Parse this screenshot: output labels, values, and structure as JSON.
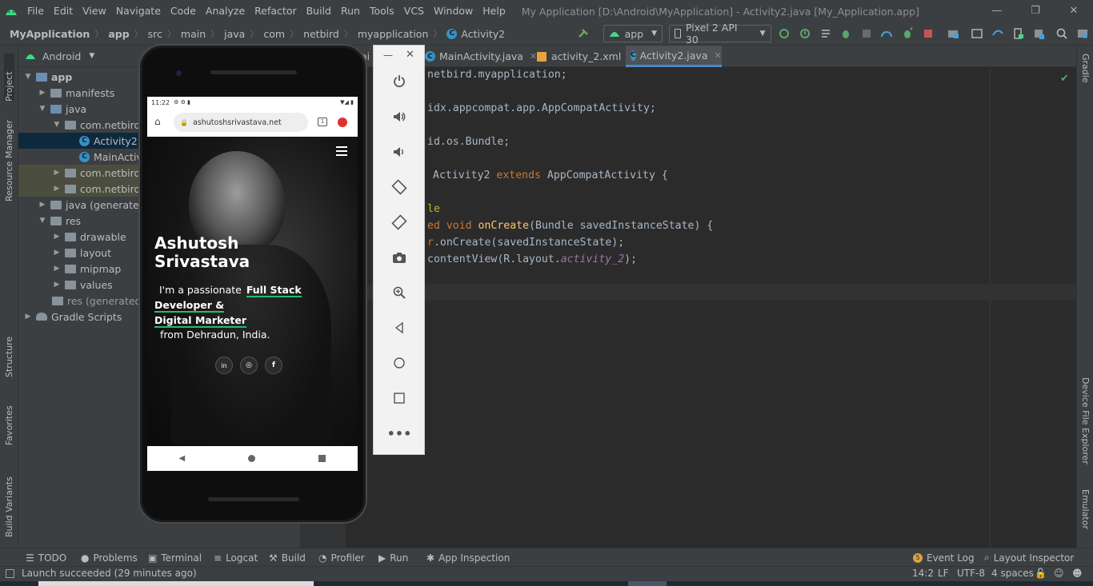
{
  "menubar": {
    "items": [
      "File",
      "Edit",
      "View",
      "Navigate",
      "Code",
      "Analyze",
      "Refactor",
      "Build",
      "Run",
      "Tools",
      "VCS",
      "Window",
      "Help"
    ],
    "title": "My Application [D:\\Android\\MyApplication] - Activity2.java [My_Application.app]"
  },
  "navbar": {
    "crumbs": [
      "MyApplication",
      "app",
      "src",
      "main",
      "java",
      "com",
      "netbird",
      "myapplication",
      "Activity2"
    ],
    "run_config": "app",
    "device": "Pixel 2 API 30"
  },
  "left_strip": {
    "project": "Project",
    "resource_manager": "Resource Manager",
    "structure": "Structure",
    "favorites": "Favorites",
    "build_variants": "Build Variants"
  },
  "right_strip": {
    "gradle": "Gradle",
    "device_file_explorer": "Device File Explorer",
    "emulator": "Emulator"
  },
  "project": {
    "view": "Android",
    "tree": [
      {
        "label": "app"
      },
      {
        "label": "manifests"
      },
      {
        "label": "java"
      },
      {
        "label": "com.netbird.n"
      },
      {
        "label": "Activity2"
      },
      {
        "label": "MainActiv"
      },
      {
        "label": "com.netbird.n"
      },
      {
        "label": "com.netbird.n"
      },
      {
        "label": "java (generated)"
      },
      {
        "label": "res"
      },
      {
        "label": "drawable"
      },
      {
        "label": "layout"
      },
      {
        "label": "mipmap"
      },
      {
        "label": "values"
      },
      {
        "label": "res (generated)"
      },
      {
        "label": "Gradle Scripts"
      }
    ]
  },
  "editor": {
    "tabs": [
      {
        "label": "ai"
      },
      {
        "label": "MainActivity.java"
      },
      {
        "label": "activity_2.xml"
      },
      {
        "label": "Activity2.java"
      }
    ],
    "code": {
      "l1": "netbird.myapplication;",
      "l2": "idx.appcompat.app.AppCompatActivity;",
      "l3": "id.os.Bundle;",
      "l4a": "Activity2 ",
      "l4b": "extends",
      "l4c": " AppCompatActivity {",
      "l5": "le",
      "l6a": "ed ",
      "l6b": "void ",
      "l6c": "onCreate",
      "l6d": "(Bundle savedInstanceState) {",
      "l7a": "r",
      "l7b": ".onCreate(savedInstanceState);",
      "l8a": "contentView(R.layout.",
      "l8b": "activity_2",
      "l8c": ");"
    }
  },
  "phone": {
    "status_time": "11:22",
    "url": "ashutoshsrivastava.net",
    "name_line1": "Ashutosh",
    "name_line2": "Srivastava",
    "intro": "I'm a passionate",
    "role1": "Full Stack Developer &",
    "role2": "Digital Marketer",
    "location": "from Dehradun, India."
  },
  "bottombar": {
    "todo": "TODO",
    "problems": "Problems",
    "terminal": "Terminal",
    "logcat": "Logcat",
    "build": "Build",
    "profiler": "Profiler",
    "run": "Run",
    "app_inspection": "App Inspection",
    "event_log": "Event Log",
    "layout_inspector": "Layout Inspector",
    "event_badge": "5"
  },
  "statusbar": {
    "message": "Launch succeeded (29 minutes ago)",
    "position": "14:2",
    "line_sep": "LF",
    "encoding": "UTF-8",
    "indent": "4 spaces"
  }
}
